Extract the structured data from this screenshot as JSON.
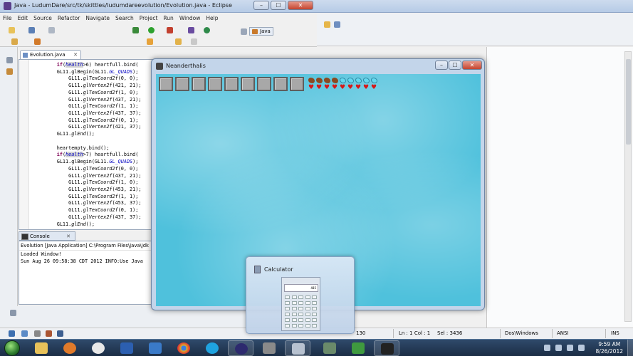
{
  "eclipse": {
    "title": "Java - LudumDare/src/tk/skittles/ludumdareevolution/Evolution.java - Eclipse",
    "menu": [
      "File",
      "Edit",
      "Source",
      "Refactor",
      "Navigate",
      "Search",
      "Project",
      "Run",
      "Window",
      "Help"
    ],
    "perspective": "Java",
    "editor_tab": "Evolution.java",
    "code": [
      [
        "if(",
        "health",
        ">6) heartfull.bind("
      ],
      [
        "GL11.glBegin(GL11.",
        "GL_QUADS",
        ");"
      ],
      [
        "    GL11.",
        "glTexCoord2f",
        "(0, 0);"
      ],
      [
        "    GL11.",
        "glVertex2f",
        "(421, 21);"
      ],
      [
        "    GL11.",
        "glTexCoord2f",
        "(1, 0);"
      ],
      [
        "    GL11.",
        "glVertex2f",
        "(437, 21);"
      ],
      [
        "    GL11.",
        "glTexCoord2f",
        "(1, 1);"
      ],
      [
        "    GL11.",
        "glVertex2f",
        "(437, 37);"
      ],
      [
        "    GL11.",
        "glTexCoord2f",
        "(0, 1);"
      ],
      [
        "    GL11.",
        "glVertex2f",
        "(421, 37);"
      ],
      [
        "GL11.",
        "glEnd",
        "();"
      ],
      [
        "",
        "",
        ""
      ],
      [
        "heartempty.bind();",
        "",
        ""
      ],
      [
        "if(",
        "health",
        ">7) heartfull.bind("
      ],
      [
        "GL11.glBegin(GL11.",
        "GL_QUADS",
        ");"
      ],
      [
        "    GL11.",
        "glTexCoord2f",
        "(0, 0);"
      ],
      [
        "    GL11.",
        "glVertex2f",
        "(437, 21);"
      ],
      [
        "    GL11.",
        "glTexCoord2f",
        "(1, 0);"
      ],
      [
        "    GL11.",
        "glVertex2f",
        "(453, 21);"
      ],
      [
        "    GL11.",
        "glTexCoord2f",
        "(1, 1);"
      ],
      [
        "    GL11.",
        "glVertex2f",
        "(453, 37);"
      ],
      [
        "    GL11.",
        "glTexCoord2f",
        "(0, 1);"
      ],
      [
        "    GL11.",
        "glVertex2f",
        "(437, 37);"
      ],
      [
        "GL11.",
        "glEnd",
        "();"
      ]
    ],
    "console_tab": "Console",
    "console_header": "Evolution [Java Application] C:\\Program Files\\Java\\jdk",
    "console_lines": [
      "Loaded Window!",
      "Sun Aug 26 09:58:38 CDT 2012 INFO:Use Java"
    ],
    "status": {
      "position_left": "130",
      "line_col": "Ln : 1    Col : 1",
      "selection": "Sel : 3436",
      "line_ending": "Dos\\Windows",
      "encoding": "ANSI",
      "insert_mode": "INS"
    }
  },
  "game": {
    "title": "Neanderthalis",
    "inventory_slots": 9,
    "hunger_full": 4,
    "hunger_total": 9,
    "hearts_full": 9,
    "sky_color": "#4fc1dc"
  },
  "calc_popup": {
    "title": "Calculator",
    "display": "485"
  },
  "taskbar": {
    "time": "9:59 AM",
    "date": "8/26/2012"
  }
}
